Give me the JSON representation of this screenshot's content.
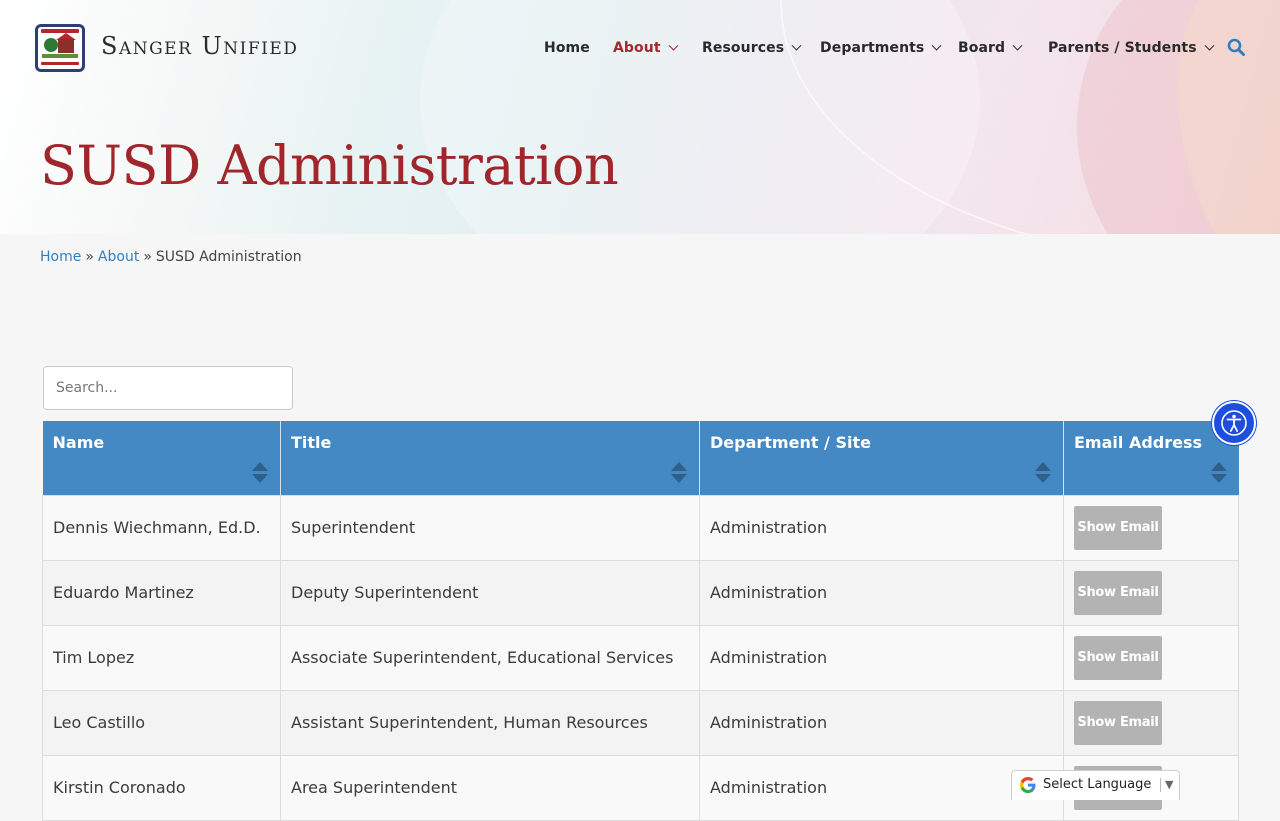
{
  "site": {
    "name": "Sanger Unified"
  },
  "nav": {
    "items": [
      {
        "label": "Home",
        "dropdown": false
      },
      {
        "label": "About",
        "dropdown": true,
        "active": true
      },
      {
        "label": "Resources",
        "dropdown": true
      },
      {
        "label": "Departments",
        "dropdown": true
      },
      {
        "label": "Board",
        "dropdown": true
      },
      {
        "label": "Parents / Students",
        "dropdown": true
      }
    ]
  },
  "page": {
    "title": "SUSD Administration"
  },
  "breadcrumb": {
    "home": "Home",
    "sep": "»",
    "about": "About",
    "current": "SUSD Administration"
  },
  "search": {
    "placeholder": "Search..."
  },
  "table": {
    "columns": [
      "Name",
      "Title",
      "Department / Site",
      "Email Address"
    ],
    "rows": [
      {
        "name": "Dennis Wiechmann, Ed.D.",
        "title": "Superintendent",
        "dept": "Administration",
        "email_button": "Show Email"
      },
      {
        "name": "Eduardo Martinez",
        "title": "Deputy Superintendent",
        "dept": "Administration",
        "email_button": "Show Email"
      },
      {
        "name": "Tim Lopez",
        "title": "Associate Superintendent, Educational Services",
        "dept": "Administration",
        "email_button": "Show Email"
      },
      {
        "name": "Leo Castillo",
        "title": "Assistant Superintendent, Human Resources",
        "dept": "Administration",
        "email_button": "Show Email"
      },
      {
        "name": "Kirstin Coronado",
        "title": "Area Superintendent",
        "dept": "Administration",
        "email_button": "Show Email"
      }
    ]
  },
  "translate": {
    "label": "Select Language",
    "arrow": "▼"
  },
  "colors": {
    "primary": "#a5282e",
    "table_header": "#4488c4",
    "link": "#2d7fc1",
    "accessibility": "#1c4fdb"
  },
  "icons": {
    "search": "search-icon",
    "accessibility": "accessibility-icon",
    "google": "google-icon"
  }
}
